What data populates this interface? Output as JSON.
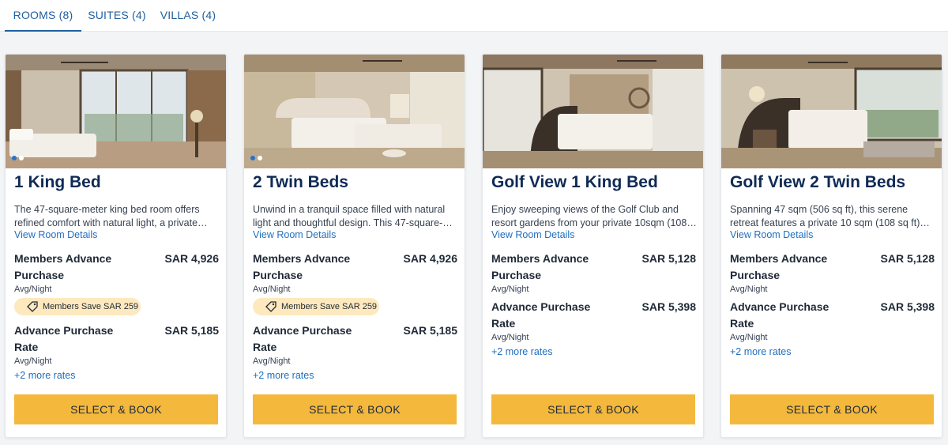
{
  "tabs": [
    {
      "label": "ROOMS (8)",
      "active": true
    },
    {
      "label": "SUITES (4)",
      "active": false
    },
    {
      "label": "VILLAS (4)",
      "active": false
    }
  ],
  "colors": {
    "accent": "#1f5fa0",
    "title": "#0f2a55",
    "book_button": "#f3b83c",
    "save_badge": "#fde9bd"
  },
  "cards": [
    {
      "title": "1 King Bed",
      "desc_line1": "The 47-square-meter king bed room offers",
      "desc_line2": "refined comfort with natural light, a private…",
      "details_link": "View Room Details",
      "rate1_name_line1": "Members Advance",
      "rate1_name_line2": "Purchase",
      "rate1_price": "SAR 4,926",
      "rate1_avg": "Avg/Night",
      "save_label": "Members Save SAR 259",
      "rate2_name_line1": "Advance Purchase",
      "rate2_name_line2": "Rate",
      "rate2_price": "SAR 5,185",
      "rate2_avg": "Avg/Night",
      "more_rates": "+2 more rates",
      "book_label": "SELECT & BOOK"
    },
    {
      "title": "2 Twin Beds",
      "desc_line1": "Unwind in a tranquil space filled with natural",
      "desc_line2": "light and thoughtful design. This 47-square-…",
      "details_link": "View Room Details",
      "rate1_name_line1": "Members Advance",
      "rate1_name_line2": "Purchase",
      "rate1_price": "SAR 4,926",
      "rate1_avg": "Avg/Night",
      "save_label": "Members Save SAR 259",
      "rate2_name_line1": "Advance Purchase",
      "rate2_name_line2": "Rate",
      "rate2_price": "SAR 5,185",
      "rate2_avg": "Avg/Night",
      "more_rates": "+2 more rates",
      "book_label": "SELECT & BOOK"
    },
    {
      "title": "Golf View 1 King Bed",
      "desc_line1": "Enjoy sweeping views of the Golf Club and",
      "desc_line2": "resort gardens from your private 10sqm (108…",
      "details_link": "View Room Details",
      "rate1_name_line1": "Members Advance",
      "rate1_name_line2": "Purchase",
      "rate1_price": "SAR 5,128",
      "rate1_avg": "Avg/Night",
      "rate2_name_line1": "Advance Purchase",
      "rate2_name_line2": "Rate",
      "rate2_price": "SAR 5,398",
      "rate2_avg": "Avg/Night",
      "more_rates": "+2 more rates",
      "book_label": "SELECT & BOOK"
    },
    {
      "title": "Golf View 2 Twin Beds",
      "desc_line1": "Spanning 47 sqm (506 sq ft), this serene",
      "desc_line2": "retreat features a private 10 sqm (108 sq ft)…",
      "details_link": "View Room Details",
      "rate1_name_line1": "Members Advance",
      "rate1_name_line2": "Purchase",
      "rate1_price": "SAR 5,128",
      "rate1_avg": "Avg/Night",
      "rate2_name_line1": "Advance Purchase",
      "rate2_name_line2": "Rate",
      "rate2_price": "SAR 5,398",
      "rate2_avg": "Avg/Night",
      "more_rates": "+2 more rates",
      "book_label": "SELECT & BOOK"
    }
  ]
}
